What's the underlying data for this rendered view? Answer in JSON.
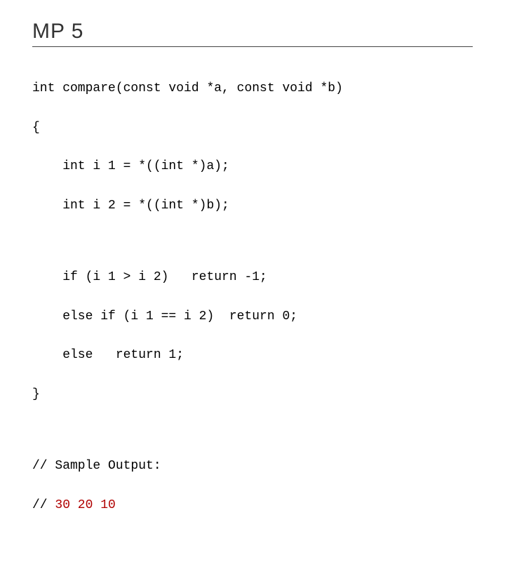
{
  "title": "MP 5",
  "code": {
    "l1": "int compare(const void *a, const void *b)",
    "l2": "{",
    "l3": "    int i 1 = *((int *)a);",
    "l4": "    int i 2 = *((int *)b);",
    "l5": "    if (i 1 > i 2)   return -1;",
    "l6": "    else if (i 1 == i 2)  return 0;",
    "l7": "    else   return 1;",
    "l8": "}",
    "l9": "// Sample Output:",
    "l10_pre": "// ",
    "l10_hl": "30 20 10"
  }
}
